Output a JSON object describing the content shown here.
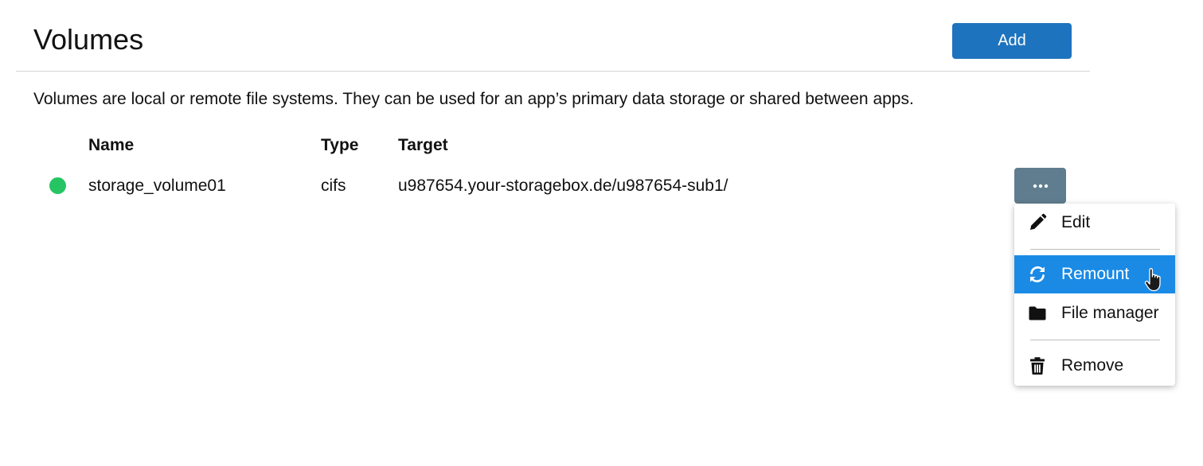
{
  "header": {
    "title": "Volumes",
    "add_label": "Add"
  },
  "description": "Volumes are local or remote file systems. They can be used for an app’s primary data storage or shared between apps.",
  "table": {
    "columns": [
      "Name",
      "Type",
      "Target"
    ],
    "rows": [
      {
        "status": "active",
        "status_color": "#27c464",
        "name": "storage_volume01",
        "type": "cifs",
        "target": "u987654.your-storagebox.de/u987654-sub1/"
      }
    ]
  },
  "actions_menu": {
    "button_icon": "more-horizontal-icon",
    "items": [
      {
        "label": "Edit",
        "icon": "pencil-icon"
      },
      {
        "label": "Remount",
        "icon": "refresh-icon",
        "highlighted": true
      },
      {
        "label": "File manager",
        "icon": "folder-icon"
      },
      {
        "label": "Remove",
        "icon": "trash-icon"
      }
    ]
  },
  "colors": {
    "primary": "#1e73be",
    "menu_highlight": "#1a8ae5",
    "actions_button": "#5f7d8e",
    "status_ok": "#27c464"
  }
}
